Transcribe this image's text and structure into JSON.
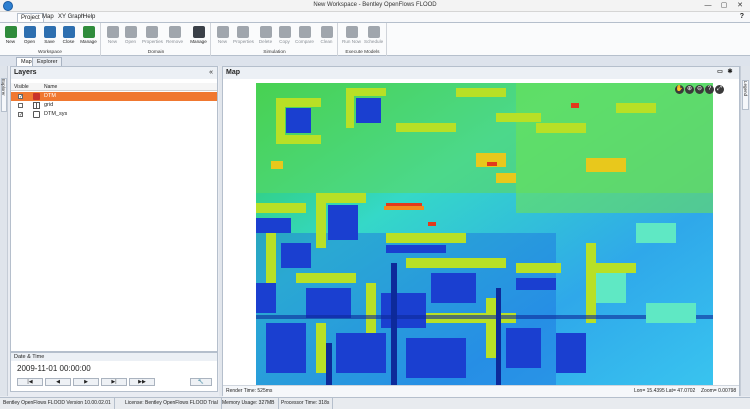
{
  "window": {
    "title": "New Workspace - Bentley OpenFlows FLOOD",
    "min": "—",
    "max": "▢",
    "close": "✕"
  },
  "menu": {
    "tabs": [
      "Project",
      "Map",
      "XY Graph",
      "Help"
    ],
    "help": "?"
  },
  "ribbon": {
    "groups": [
      {
        "label": "Workspace",
        "buttons": [
          "New",
          "Open",
          "Save",
          "Close",
          "Manage"
        ]
      },
      {
        "label": "Domain",
        "buttons": [
          "New",
          "Open",
          "Properties",
          "Remove",
          "Manage"
        ]
      },
      {
        "label": "Simulation",
        "buttons": [
          "New",
          "Properties",
          "Delete",
          "Copy",
          "Compare",
          "Clean"
        ]
      },
      {
        "label": "Execute Models",
        "buttons": [
          "Run Now",
          "Schedule"
        ]
      }
    ]
  },
  "doctabs": [
    "Map",
    "Explorer"
  ],
  "left_strip": {
    "tab": "Explorer"
  },
  "layers": {
    "title": "Layers",
    "collapse": "«",
    "columns": {
      "visible": "Visible",
      "name": "Name"
    },
    "rows": [
      {
        "name": "DTM",
        "checked": "✓",
        "selected": true
      },
      {
        "name": "grid",
        "checked": "",
        "selected": false
      },
      {
        "name": "DTM_sys",
        "checked": "✓",
        "selected": false
      }
    ]
  },
  "datetime": {
    "title": "Date & Time",
    "value": "2009-11-01 00:00:00",
    "buttons": [
      "|◀",
      "◀",
      "▶",
      "▶|",
      "▶▶"
    ],
    "tool": "🔧"
  },
  "map": {
    "title": "Map",
    "tool_icons": [
      "✋",
      "⊕",
      "⊖",
      "?",
      "⤢"
    ],
    "render_time": "Render Time: 525ms",
    "lon": "Lon= 15.4395",
    "lat": "Lat= 47.0702",
    "zoom": "Zoom= 0.00798"
  },
  "right_strip": {
    "tab": "Legend"
  },
  "status": {
    "version": "Bentley OpenFlows FLOOD Version 10.00.02.01",
    "license": "License: Bentley OpenFlows FLOOD Trial",
    "memory": "Memory Usage: 327MB",
    "processor": "Processor Time: 318s"
  },
  "colors": {
    "accent": "#f07830",
    "ribbon_blue": "#2d6fb0",
    "ribbon_green": "#2f8c3c"
  }
}
